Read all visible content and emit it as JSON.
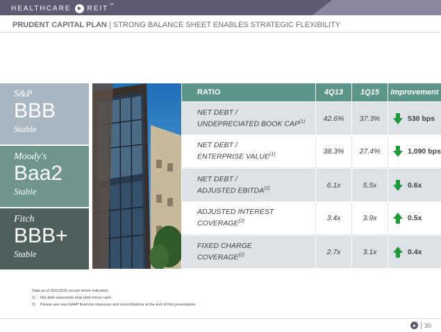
{
  "header": {
    "brand_left": "HEALTHCARE",
    "brand_right": "REIT",
    "brand_mark": "™",
    "title_bold": "PRUDENT CAPITAL PLAN",
    "title_separator": " | ",
    "title_rest": "STRONG BALANCE SHEET ENABLES STRATEGIC FLEXIBILITY"
  },
  "ratings": [
    {
      "agency": "S&P",
      "grade": "BBB",
      "outlook": "Stable",
      "color": "#a9b7c2"
    },
    {
      "agency": "Moody's",
      "grade": "Baa2",
      "outlook": "Stable",
      "color": "#6f958d"
    },
    {
      "agency": "Fitch",
      "grade": "BBB+",
      "outlook": "Stable",
      "color": "#4e5f5e"
    }
  ],
  "table": {
    "headers": {
      "ratio": "RATIO",
      "col1": "4Q13",
      "col2": "1Q15",
      "improvement": "Improvement"
    },
    "rows": [
      {
        "line1": "NET DEBT /",
        "line2": "UNDEPRECIATED BOOK CAP",
        "note": "(1)",
        "v1": "42.6%",
        "v2": "37.3%",
        "direction": "down",
        "improvement": "530 bps"
      },
      {
        "line1": "NET DEBT /",
        "line2": "ENTERPRISE VALUE",
        "note": "(1)",
        "v1": "38.3%",
        "v2": "27.4%",
        "direction": "down",
        "improvement": "1,090 bps"
      },
      {
        "line1": "NET DEBT /",
        "line2": "ADJUSTED EBITDA",
        "note": "(2)",
        "v1": "6.1x",
        "v2": "5.5x",
        "direction": "down",
        "improvement": "0.6x"
      },
      {
        "line1": "ADJUSTED INTEREST",
        "line2": "COVERAGE",
        "note": "(2)",
        "v1": "3.4x",
        "v2": "3.9x",
        "direction": "up",
        "improvement": "0.5x"
      },
      {
        "line1": "FIXED CHARGE",
        "line2": "COVERAGE",
        "note": "(2)",
        "v1": "2.7x",
        "v2": "3.1x",
        "direction": "up",
        "improvement": "0.4x"
      }
    ]
  },
  "notes": {
    "intro": "Data as of 3/31/2015 except where indicated.",
    "items": [
      {
        "num": "1)",
        "text": "Net debt represents total debt minus cash."
      },
      {
        "num": "2)",
        "text": "Please see non-GAAP financial measures and reconciliations at the end of this presentation."
      }
    ]
  },
  "footer": {
    "page": "30"
  },
  "colors": {
    "accent_purple": "#5e5b72",
    "table_header": "#5c958a",
    "arrow_green": "#1f9a3a"
  }
}
